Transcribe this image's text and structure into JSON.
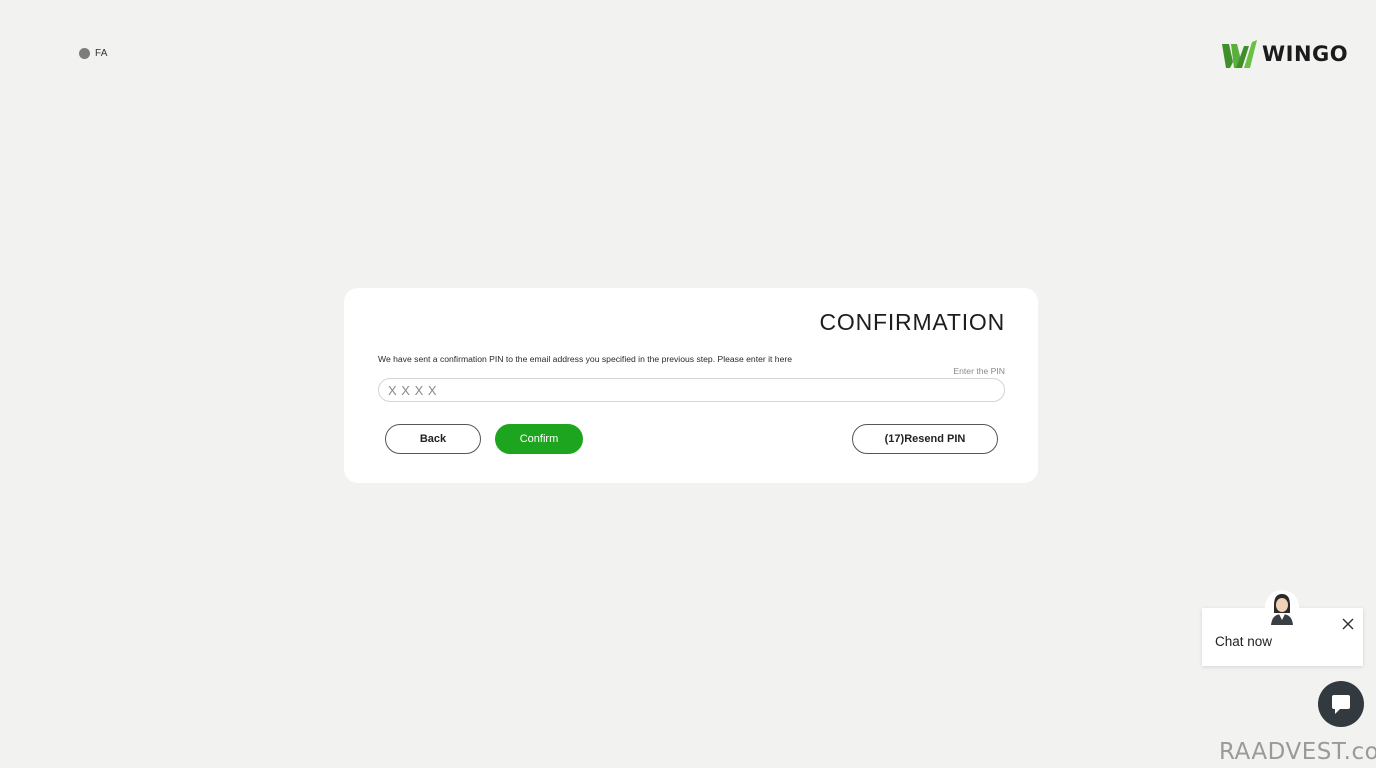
{
  "language": {
    "label": "FA"
  },
  "brand": {
    "name": "WINGO",
    "accent_color": "#4a9a2e"
  },
  "confirmation": {
    "title": "CONFIRMATION",
    "instruction": "We have sent a confirmation PIN to the email address you specified in the previous step. Please enter it here",
    "pin_label": "Enter the PIN",
    "pin_placeholder": "X X X X",
    "pin_value": "",
    "back_label": "Back",
    "confirm_label": "Confirm",
    "resend_label": "(17)Resend PIN",
    "confirm_color": "#1ea51f"
  },
  "chat": {
    "text": "Chat now",
    "close_icon": "close-icon",
    "launcher_icon": "chat-bubble-icon"
  },
  "watermark": {
    "text": "RAADVEST.com"
  }
}
